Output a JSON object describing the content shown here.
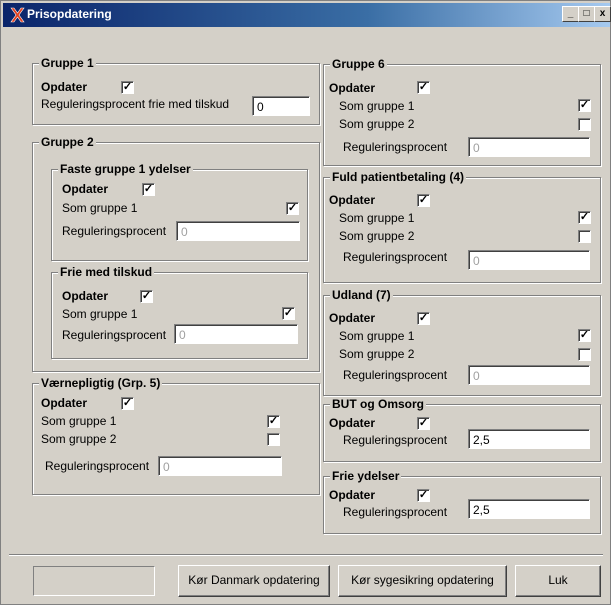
{
  "window": {
    "title": "Prisopdatering"
  },
  "titlebar_buttons": {
    "minimize": "_",
    "maximize": "□",
    "close": "x"
  },
  "check_mark": "✓",
  "g1": {
    "title": "Gruppe 1",
    "opdater": "Opdater",
    "label": "Reguleringsprocent frie med tilskud",
    "value": "0"
  },
  "g2": {
    "title": "Gruppe 2"
  },
  "faste": {
    "title": "Faste gruppe 1 ydelser",
    "opdater": "Opdater",
    "som1": "Som gruppe 1",
    "reg": "Reguleringsprocent",
    "value": "0"
  },
  "frie_t": {
    "title": "Frie med tilskud",
    "opdater": "Opdater",
    "som1": "Som gruppe 1",
    "reg": "Reguleringsprocent",
    "value": "0"
  },
  "vaern": {
    "title": "Værnepligtig (Grp. 5)",
    "opdater": "Opdater",
    "som1": "Som gruppe 1",
    "som2": "Som gruppe 2",
    "reg": "Reguleringsprocent",
    "value": "0"
  },
  "g6": {
    "title": "Gruppe 6",
    "opdater": "Opdater",
    "som1": "Som gruppe 1",
    "som2": "Som gruppe 2",
    "reg": "Reguleringsprocent",
    "value": "0"
  },
  "fuld": {
    "title": "Fuld patientbetaling (4)",
    "opdater": "Opdater",
    "som1": "Som gruppe 1",
    "som2": "Som gruppe 2",
    "reg": "Reguleringsprocent",
    "value": "0"
  },
  "udland": {
    "title": "Udland (7)",
    "opdater": "Opdater",
    "som1": "Som gruppe 1",
    "som2": "Som gruppe 2",
    "reg": "Reguleringsprocent",
    "value": "0"
  },
  "but": {
    "title": "BUT og Omsorg",
    "opdater": "Opdater",
    "reg": "Reguleringsprocent",
    "value": "2,5"
  },
  "frie_y": {
    "title": "Frie ydelser",
    "opdater": "Opdater",
    "reg": "Reguleringsprocent",
    "value": "2,5"
  },
  "buttons": {
    "danmark": "Kør Danmark opdatering",
    "sygesikring": "Kør sygesikring opdatering",
    "luk": "Luk"
  }
}
